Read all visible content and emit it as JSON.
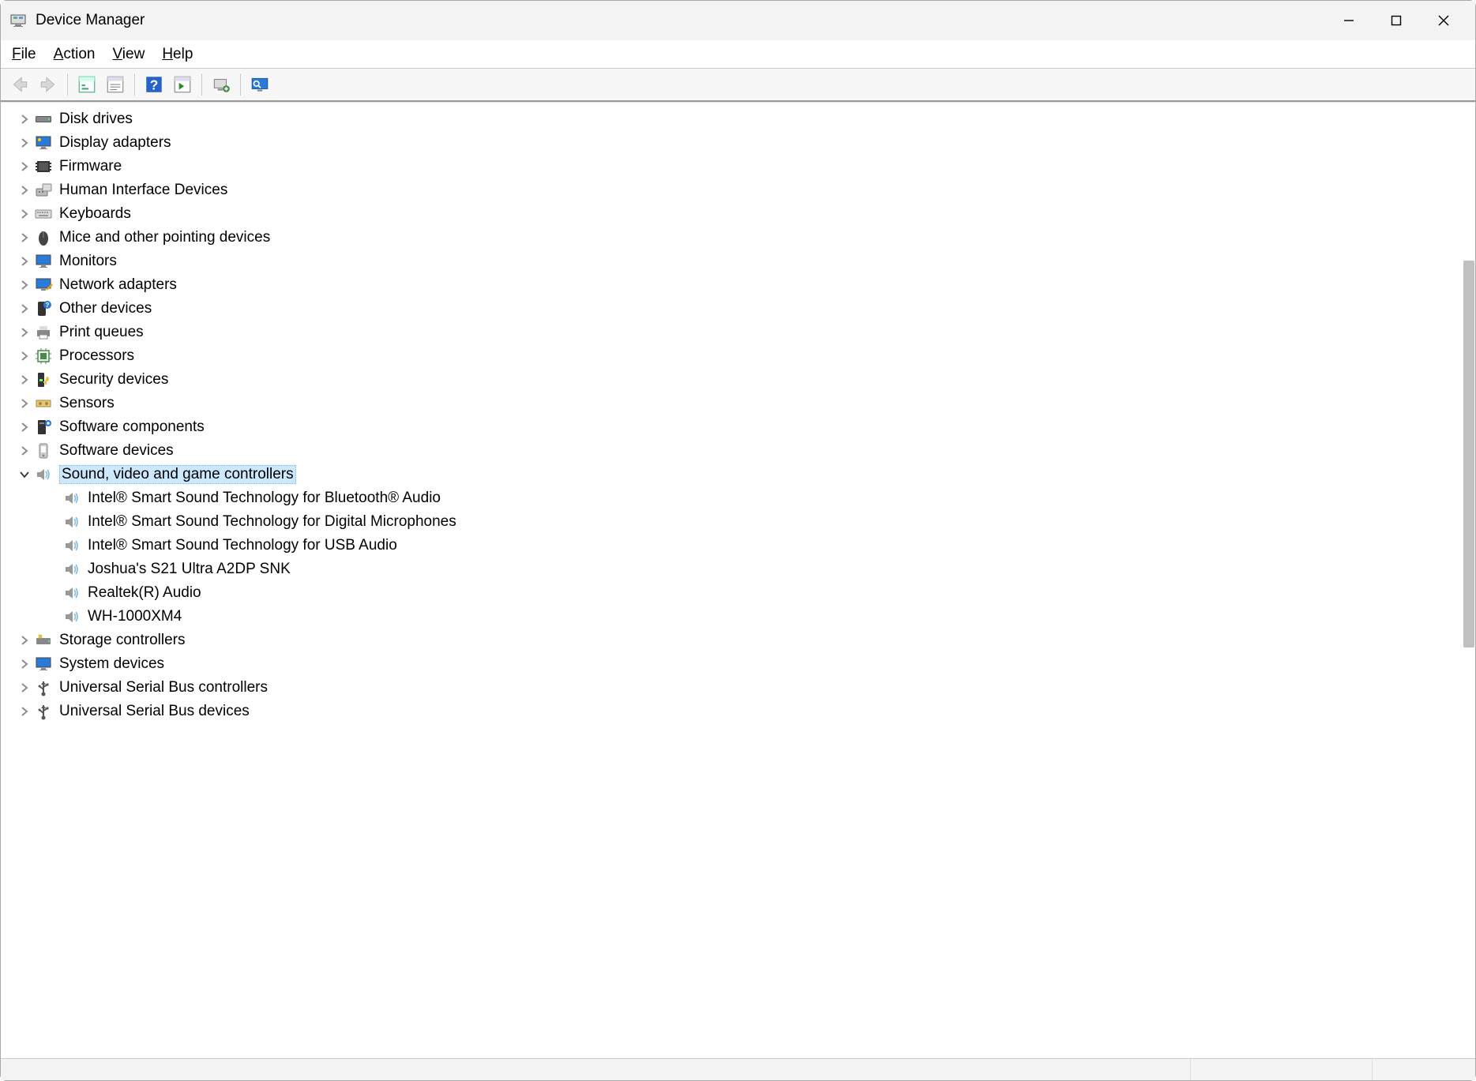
{
  "window": {
    "title": "Device Manager"
  },
  "menubar": {
    "file": "File",
    "action": "Action",
    "view": "View",
    "help": "Help"
  },
  "tree": {
    "categories": [
      {
        "label": "Disk drives",
        "icon": "disk",
        "expanded": false,
        "selected": false
      },
      {
        "label": "Display adapters",
        "icon": "display",
        "expanded": false,
        "selected": false
      },
      {
        "label": "Firmware",
        "icon": "firmware",
        "expanded": false,
        "selected": false
      },
      {
        "label": "Human Interface Devices",
        "icon": "hid",
        "expanded": false,
        "selected": false
      },
      {
        "label": "Keyboards",
        "icon": "keyboard",
        "expanded": false,
        "selected": false
      },
      {
        "label": "Mice and other pointing devices",
        "icon": "mouse",
        "expanded": false,
        "selected": false
      },
      {
        "label": "Monitors",
        "icon": "monitor",
        "expanded": false,
        "selected": false
      },
      {
        "label": "Network adapters",
        "icon": "network",
        "expanded": false,
        "selected": false
      },
      {
        "label": "Other devices",
        "icon": "other",
        "expanded": false,
        "selected": false
      },
      {
        "label": "Print queues",
        "icon": "printer",
        "expanded": false,
        "selected": false
      },
      {
        "label": "Processors",
        "icon": "cpu",
        "expanded": false,
        "selected": false
      },
      {
        "label": "Security devices",
        "icon": "security",
        "expanded": false,
        "selected": false
      },
      {
        "label": "Sensors",
        "icon": "sensor",
        "expanded": false,
        "selected": false
      },
      {
        "label": "Software components",
        "icon": "swcomp",
        "expanded": false,
        "selected": false
      },
      {
        "label": "Software devices",
        "icon": "swdev",
        "expanded": false,
        "selected": false
      },
      {
        "label": "Sound, video and game controllers",
        "icon": "sound",
        "expanded": true,
        "selected": true,
        "children": [
          {
            "label": "Intel® Smart Sound Technology for Bluetooth® Audio",
            "icon": "sound"
          },
          {
            "label": "Intel® Smart Sound Technology for Digital Microphones",
            "icon": "sound"
          },
          {
            "label": "Intel® Smart Sound Technology for USB Audio",
            "icon": "sound"
          },
          {
            "label": "Joshua's S21 Ultra A2DP SNK",
            "icon": "sound"
          },
          {
            "label": "Realtek(R) Audio",
            "icon": "sound"
          },
          {
            "label": "WH-1000XM4",
            "icon": "sound"
          }
        ]
      },
      {
        "label": "Storage controllers",
        "icon": "storage",
        "expanded": false,
        "selected": false
      },
      {
        "label": "System devices",
        "icon": "system",
        "expanded": false,
        "selected": false
      },
      {
        "label": "Universal Serial Bus controllers",
        "icon": "usb",
        "expanded": false,
        "selected": false
      },
      {
        "label": "Universal Serial Bus devices",
        "icon": "usb",
        "expanded": false,
        "selected": false
      }
    ]
  }
}
